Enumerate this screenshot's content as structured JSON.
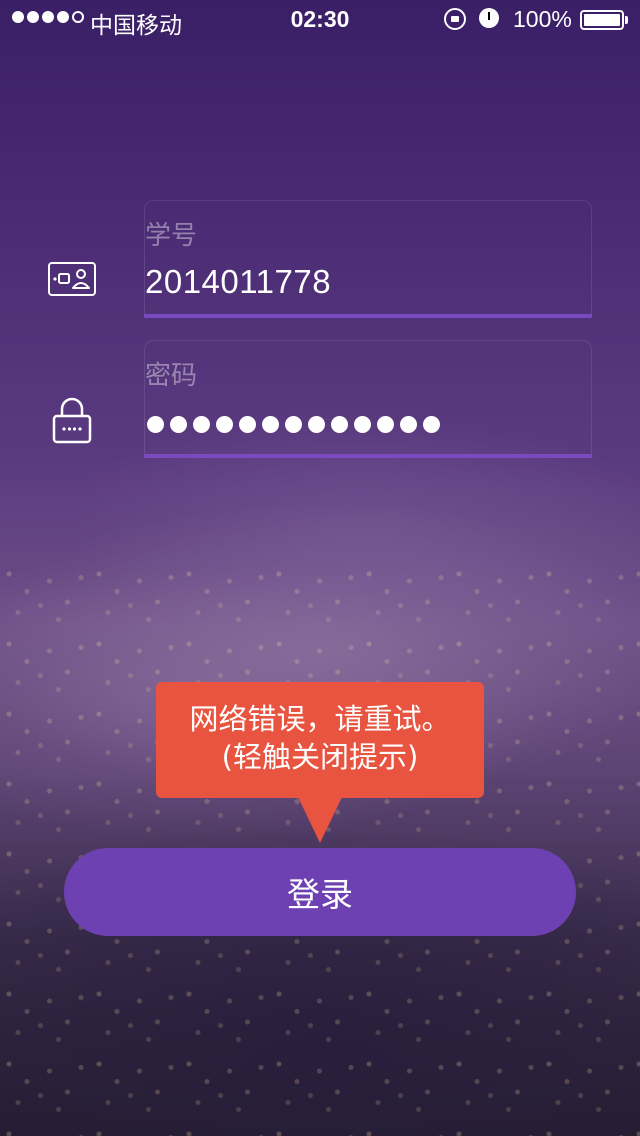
{
  "status_bar": {
    "carrier": "中国移动",
    "time": "02:30",
    "battery_percent": "100%",
    "signal_bars_filled": 4,
    "signal_bars_total": 5
  },
  "form": {
    "student_id": {
      "label": "学号",
      "value": "2014011778",
      "icon": "id-card-icon"
    },
    "password": {
      "label": "密码",
      "masked_length": 13,
      "icon": "lock-icon"
    },
    "accent_color": "#7a4bc0"
  },
  "tooltip": {
    "line1": "网络错误，请重试。",
    "line2": "(轻触关闭提示)",
    "color": "#e8543f"
  },
  "login_button": {
    "label": "登录",
    "color": "#6e41b2"
  }
}
